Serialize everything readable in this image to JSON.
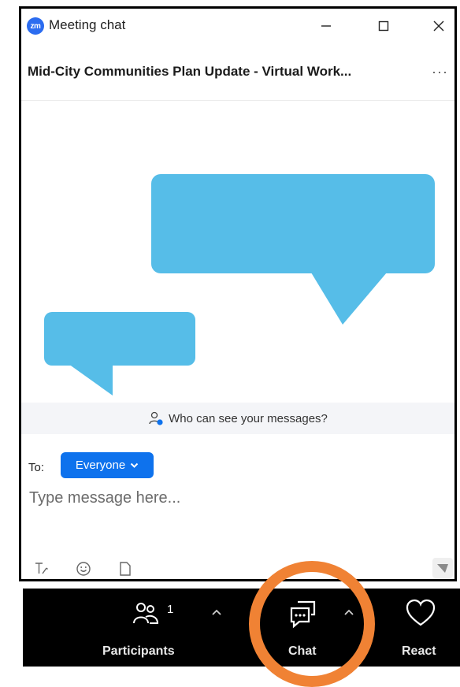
{
  "window": {
    "app_logo_text": "zm",
    "title": "Meeting chat"
  },
  "meeting": {
    "title": "Mid-City Communities Plan Update - Virtual Work...",
    "more_icon": "more-dots-icon"
  },
  "info_bar": {
    "text": "Who can see your messages?",
    "icon": "people-info-icon"
  },
  "compose": {
    "to_label": "To:",
    "recipient": "Everyone",
    "placeholder": "Type message here..."
  },
  "toolbar": {
    "participants_label": "Participants",
    "participants_count": "1",
    "chat_label": "Chat",
    "react_label": "React"
  },
  "colors": {
    "bubble": "#56bde8",
    "recipient_pill": "#0e72ed",
    "highlight_ring": "#f08234",
    "toolbar_bg": "#000000"
  }
}
